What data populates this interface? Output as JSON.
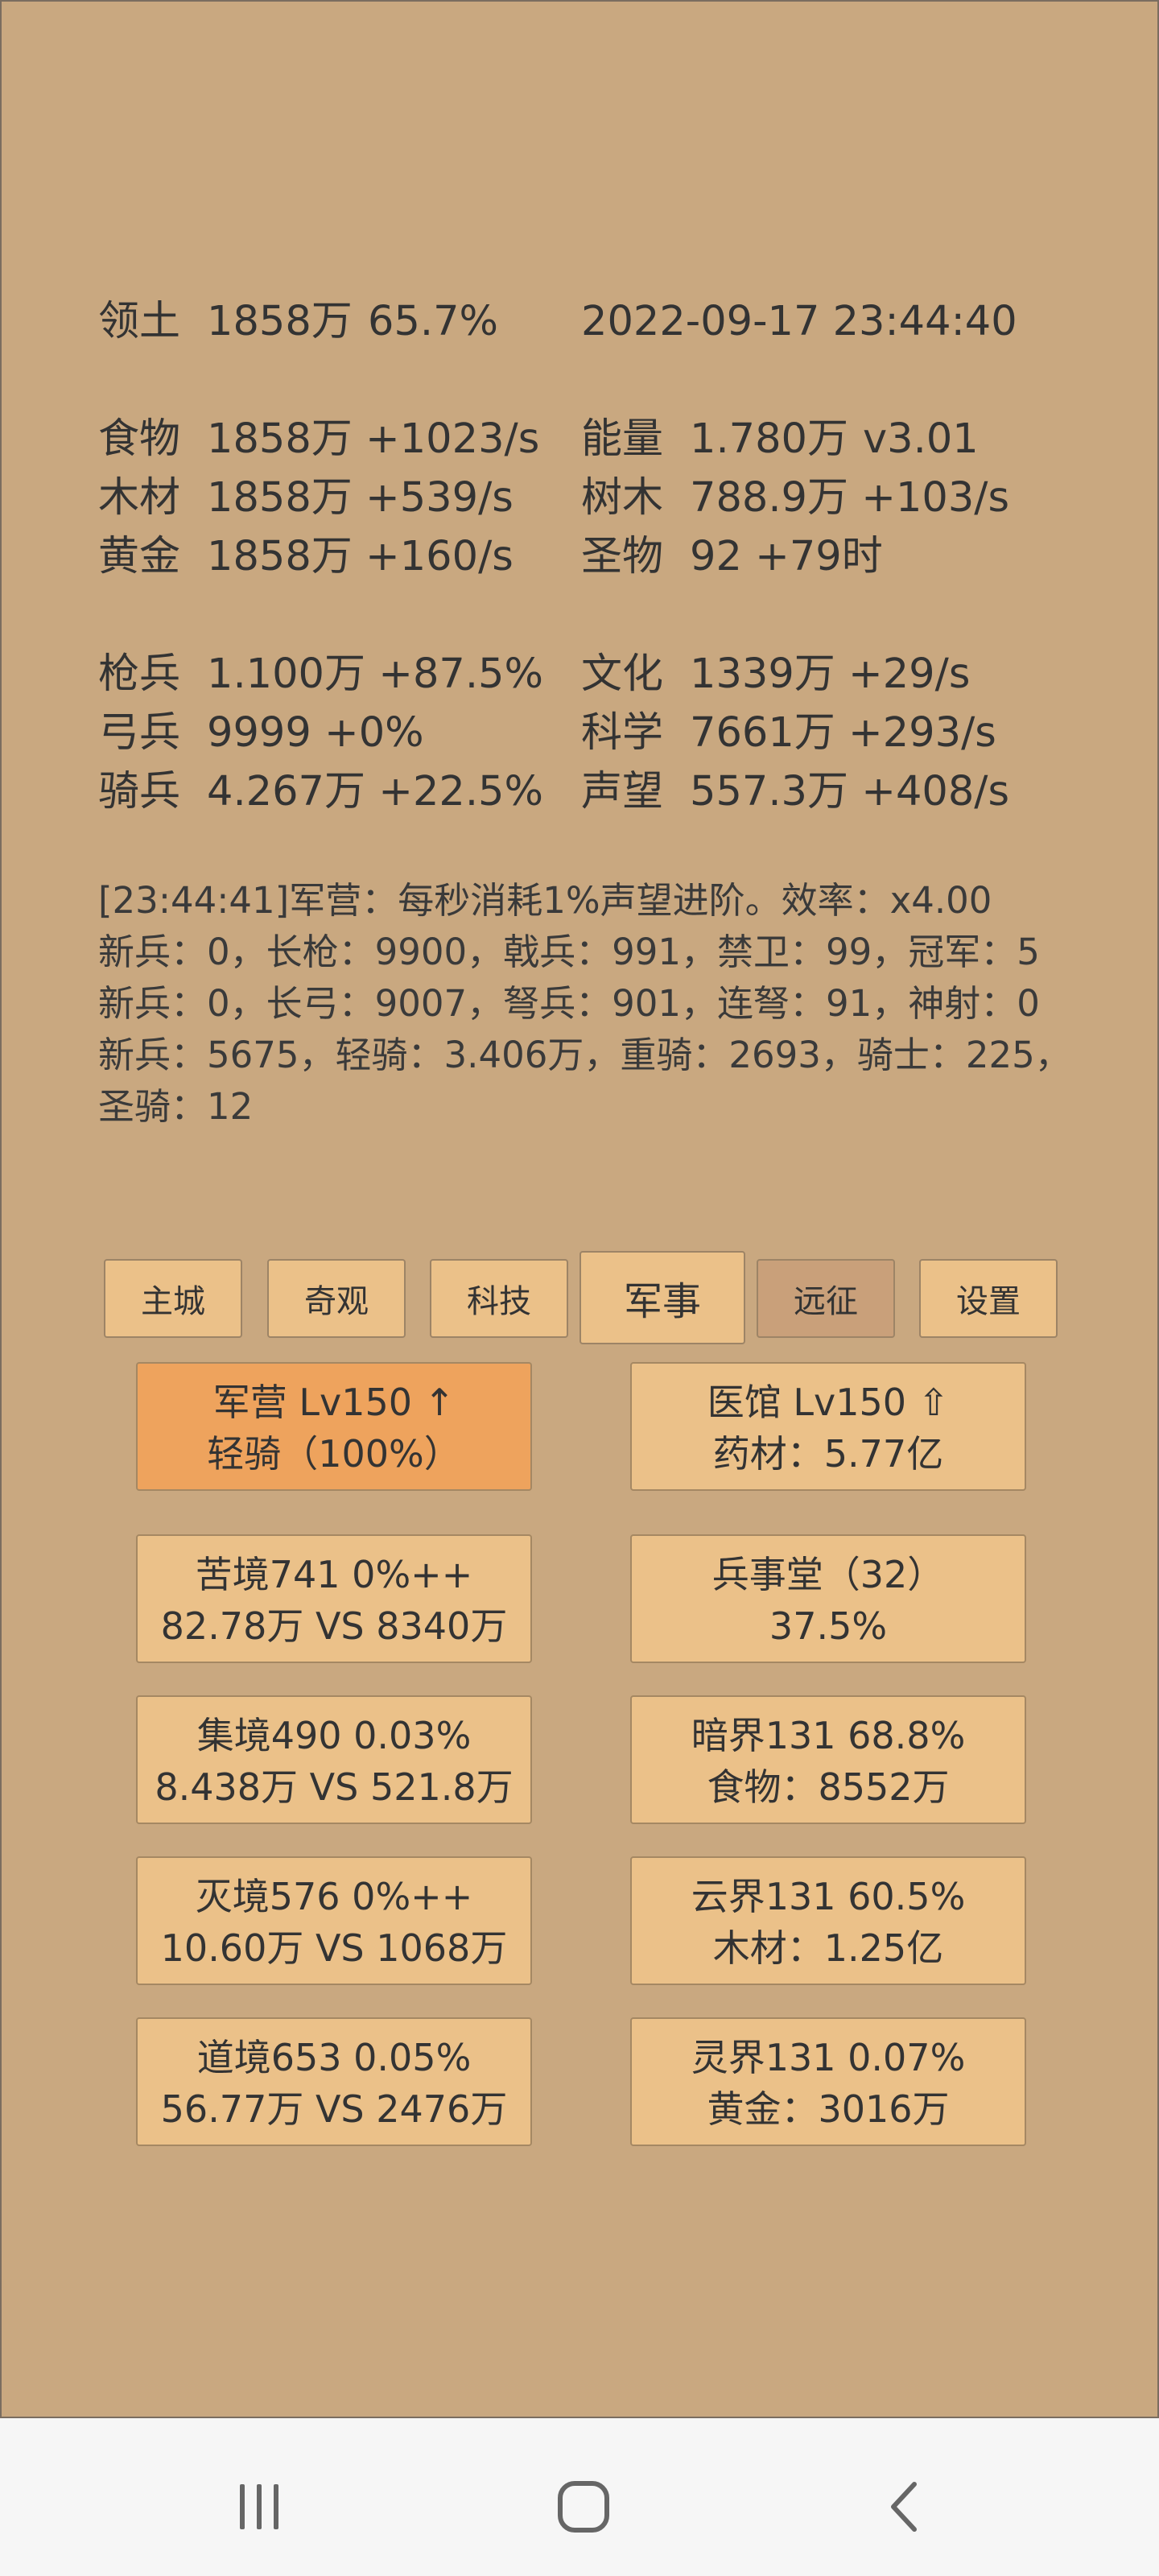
{
  "stats": {
    "territory": {
      "label": "领土",
      "value": "1858万",
      "pct": "65.7%"
    },
    "datetime": "2022-09-17 23:44:40",
    "food": {
      "label": "食物",
      "value": "1858万 +1023/s"
    },
    "wood": {
      "label": "木材",
      "value": "1858万 +539/s"
    },
    "gold": {
      "label": "黄金",
      "value": "1858万 +160/s"
    },
    "energy": {
      "label": "能量",
      "value": "1.780万",
      "version": "v3.01"
    },
    "tree": {
      "label": "树木",
      "value": "788.9万 +103/s"
    },
    "relic": {
      "label": "圣物",
      "value": "92 +79时"
    },
    "spear": {
      "label": "枪兵",
      "value": "1.100万 +87.5%"
    },
    "archer": {
      "label": "弓兵",
      "value": "9999 +0%"
    },
    "cavalry": {
      "label": "骑兵",
      "value": "4.267万 +22.5%"
    },
    "culture": {
      "label": "文化",
      "value": "1339万 +29/s"
    },
    "science": {
      "label": "科学",
      "value": "7661万 +293/s"
    },
    "prestige": {
      "label": "声望",
      "value": "557.3万 +408/s"
    }
  },
  "log": [
    "[23:44:41]军营：每秒消耗1%声望进阶。效率：x4.00",
    "新兵：0，长枪：9900，戟兵：991，禁卫：99，冠军：5",
    "新兵：0，长弓：9007，弩兵：901，连弩：91，神射：0",
    "新兵：5675，轻骑：3.406万，重骑：2693，骑士：225，",
    "圣骑：12"
  ],
  "tabs": {
    "main_city": "主城",
    "wonders": "奇观",
    "tech": "科技",
    "military": "军事",
    "expedition": "远征",
    "settings": "设置"
  },
  "cards": [
    {
      "line1": "军营 Lv150 ↑",
      "line2": "轻骑（100%）"
    },
    {
      "line1": "医馆 Lv150 ⇧",
      "line2": "药材：5.77亿"
    },
    {
      "line1": "苦境741  0%++",
      "line2": "82.78万 VS 8340万"
    },
    {
      "line1": "兵事堂（32）",
      "line2": "37.5%"
    },
    {
      "line1": "集境490  0.03%",
      "line2": "8.438万 VS 521.8万"
    },
    {
      "line1": "暗界131  68.8%",
      "line2": "食物：8552万"
    },
    {
      "line1": "灭境576  0%++",
      "line2": "10.60万 VS 1068万"
    },
    {
      "line1": "云界131  60.5%",
      "line2": "木材：1.25亿"
    },
    {
      "line1": "道境653  0.05%",
      "line2": "56.77万 VS 2476万"
    },
    {
      "line1": "灵界131  0.07%",
      "line2": "黄金：3016万"
    }
  ],
  "nav_icons": [
    "recent-apps-icon",
    "home-icon",
    "back-icon"
  ],
  "colors": {
    "background": "#c9a880",
    "button": "#ebc189",
    "highlight": "#eea35d",
    "dim_tab": "#c9a07a"
  }
}
